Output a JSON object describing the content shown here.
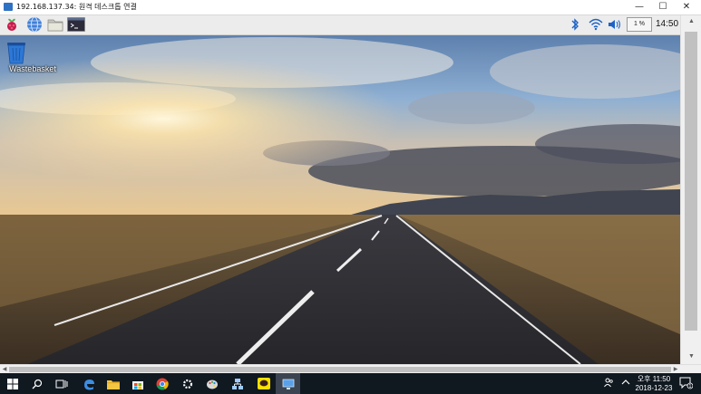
{
  "window": {
    "title": "192.168.137.34: 원격 데스크톱 연결",
    "minimize": "—",
    "maximize": "☐",
    "close": "✕"
  },
  "panel": {
    "launchers": [
      "raspberry-menu",
      "web-browser",
      "file-manager",
      "terminal"
    ],
    "cpu": "1 %",
    "clock": "14:50"
  },
  "desktop": {
    "icons": [
      {
        "label": "Wastebasket",
        "icon": "wastebasket-icon"
      }
    ]
  },
  "taskbar": {
    "apps": [
      "file-explorer",
      "store",
      "chrome",
      "settings",
      "paint",
      "network",
      "kakaotalk",
      "remote-desktop"
    ],
    "time": "오후 11:50",
    "date": "2018-12-23",
    "notification_count": "1"
  },
  "colors": {
    "taskbar_bg": "#101820",
    "panel_bg": "#ececec",
    "accent_blue": "#2f72c4"
  }
}
